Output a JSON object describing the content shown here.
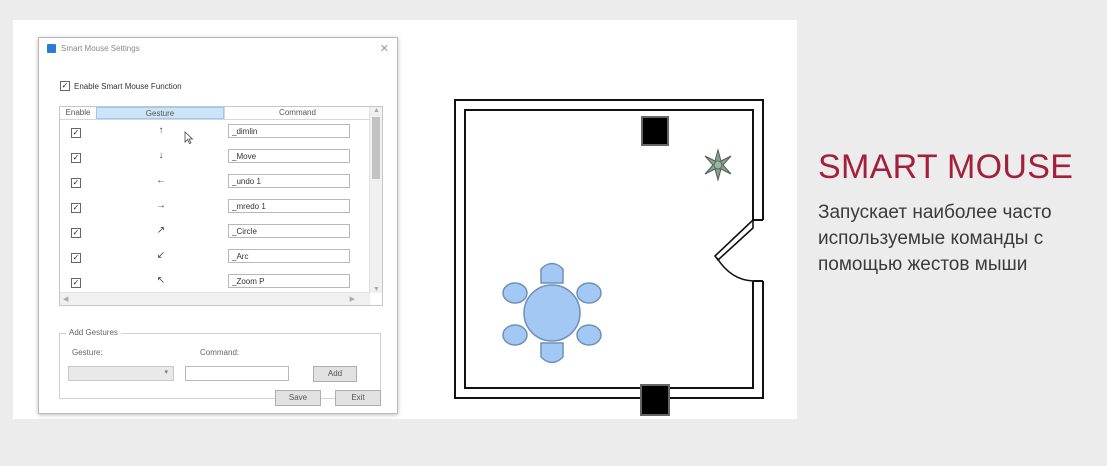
{
  "dialog": {
    "title": "Smart Mouse Settings",
    "close_glyph": "✕",
    "enable_checkbox": {
      "checked": true,
      "label": "Enable Smart Mouse Function"
    },
    "table": {
      "headers": {
        "enable": "Enable",
        "gesture": "Gesture",
        "command": "Command"
      },
      "rows": [
        {
          "enabled": true,
          "gesture": "↑",
          "command": "_dimlin"
        },
        {
          "enabled": true,
          "gesture": "↓",
          "command": "_Move"
        },
        {
          "enabled": true,
          "gesture": "←",
          "command": "_undo 1"
        },
        {
          "enabled": true,
          "gesture": "→",
          "command": "_mredo 1"
        },
        {
          "enabled": true,
          "gesture": "↗",
          "command": "_Circle"
        },
        {
          "enabled": true,
          "gesture": "↙",
          "command": "_Arc"
        },
        {
          "enabled": true,
          "gesture": "↖",
          "command": "_Zoom P"
        }
      ]
    },
    "add_gestures": {
      "legend": "Add Gestures",
      "gesture_label": "Gesture:",
      "command_label": "Command:",
      "gesture_value": "",
      "command_value": "",
      "add_button": "Add"
    },
    "save_button": "Save",
    "exit_button": "Exit"
  },
  "side": {
    "heading": "SMART MOUSE",
    "description": "Запускает наиболее часто используемые команды с помощью жестов мыши"
  },
  "colors": {
    "accent": "#a3203a",
    "table_fill": "#a4c8f4",
    "table_stroke": "#6f90b8",
    "header_highlight": "#cce4f7"
  },
  "icons": {
    "plant": "plant-icon",
    "cursor": "cursor-icon",
    "checkmark": "checkmark-icon"
  }
}
